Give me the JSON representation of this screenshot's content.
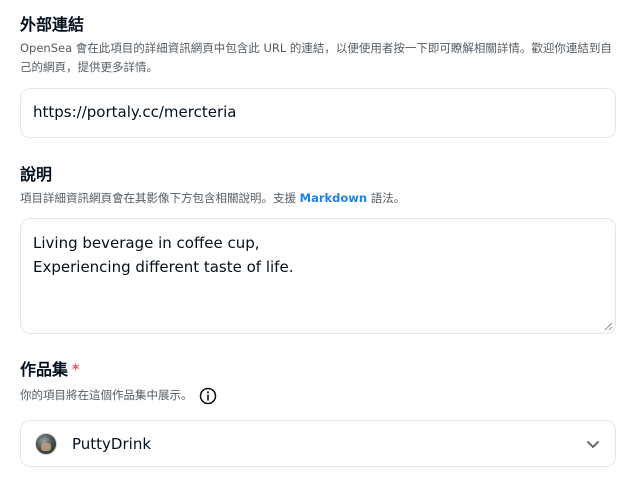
{
  "external_link": {
    "title": "外部連結",
    "description": "OpenSea 會在此項目的詳細資訊網頁中包含此 URL 的連結，以便使用者按一下即可瞭解相關詳情。歡迎你連結到自己的網頁，提供更多詳情。",
    "value": "https://portaly.cc/mercteria"
  },
  "description_section": {
    "title": "說明",
    "description_before": "項目詳細資訊網頁會在其影像下方包含相關說明。支援 ",
    "description_link": "Markdown",
    "description_after": " 語法。",
    "value": "Living beverage in coffee cup,\nExperiencing different taste of life."
  },
  "collection": {
    "title": "作品集",
    "required_mark": "*",
    "description": "你的項目將在這個作品集中展示。",
    "selected": "PuttyDrink",
    "icons": {
      "info": "info-icon",
      "chevron": "chevron-down-icon",
      "avatar": "avatar"
    }
  },
  "colors": {
    "text": "#04111d",
    "muted": "#545c66",
    "link": "#2081e2",
    "required": "#eb5757",
    "border": "#e5e8eb"
  }
}
